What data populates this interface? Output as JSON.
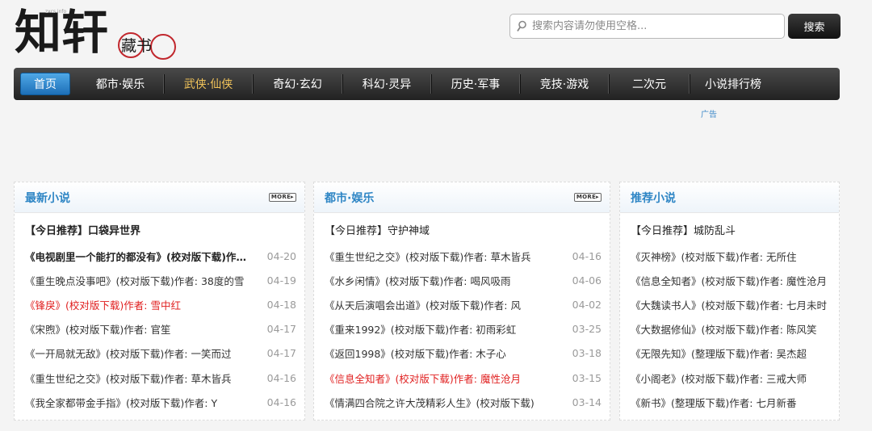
{
  "logo": {
    "name": "知轩藏书",
    "main_text": "知轩",
    "seal_text": "藏书",
    "small_text": "zxcs.info"
  },
  "search": {
    "placeholder": "搜索内容请勿使用空格...",
    "button_label": "搜索",
    "icon": "search-icon"
  },
  "nav": {
    "items": [
      {
        "label": "首页"
      },
      {
        "label": "都市·娱乐"
      },
      {
        "label": "武侠·仙侠"
      },
      {
        "label": "奇幻·玄幻"
      },
      {
        "label": "科幻·灵异"
      },
      {
        "label": "历史·军事"
      },
      {
        "label": "竞技·游戏"
      },
      {
        "label": "二次元"
      },
      {
        "label": "小说排行榜"
      }
    ]
  },
  "ad_label": "广告",
  "colors": {
    "accent_blue": "#2f86c5",
    "highlight_red": "#e02020",
    "nav_active": "#f2c45a"
  },
  "panels": [
    {
      "title": "最新小说",
      "more": "MORE",
      "featured": "【今日推荐】口袋异世界",
      "rows": [
        {
          "title": "《电视剧里一个能打的都没有》(校对版下载)作者: 吃瓜子群众",
          "date": "04-20"
        },
        {
          "title": "《重生晚点没事吧》(校对版下载)作者: 38度的雪",
          "date": "04-19"
        },
        {
          "title": "《锋戾》(校对版下载)作者: 雪中红",
          "date": "04-18"
        },
        {
          "title": "《宋煦》(校对版下载)作者: 官笙",
          "date": "04-17"
        },
        {
          "title": "《一开局就无敌》(校对版下载)作者: 一笑而过",
          "date": "04-17"
        },
        {
          "title": "《重生世纪之交》(校对版下载)作者: 草木皆兵",
          "date": "04-16"
        },
        {
          "title": "《我全家都带金手指》(校对版下载)作者: Y",
          "date": "04-16"
        }
      ]
    },
    {
      "title": "都市·娱乐",
      "more": "MORE",
      "featured": "【今日推荐】守护神域",
      "rows": [
        {
          "title": "《重生世纪之交》(校对版下载)作者: 草木皆兵",
          "date": "04-16"
        },
        {
          "title": "《水乡闲情》(校对版下载)作者: 喝风吸雨",
          "date": "04-06"
        },
        {
          "title": "《从天后演唱会出道》(校对版下载)作者: 风",
          "date": "04-02"
        },
        {
          "title": "《重来1992》(校对版下载)作者: 初雨彩虹",
          "date": "03-25"
        },
        {
          "title": "《返回1998》(校对版下载)作者: 木子心",
          "date": "03-18"
        },
        {
          "title": "《信息全知者》(校对版下载)作者: 魔性沧月",
          "date": "03-15"
        },
        {
          "title": "《情满四合院之许大茂精彩人生》(校对版下载)",
          "date": "03-14"
        }
      ]
    },
    {
      "title": "推荐小说",
      "featured": "【今日推荐】城防乱斗",
      "rows": [
        {
          "title": "《灭神榜》(校对版下载)作者: 无所住"
        },
        {
          "title": "《信息全知者》(校对版下载)作者: 魔性沧月"
        },
        {
          "title": "《大魏读书人》(校对版下载)作者: 七月未时"
        },
        {
          "title": "《大数据修仙》(校对版下载)作者: 陈风笑"
        },
        {
          "title": "《无限先知》(整理版下载)作者: 吴杰超"
        },
        {
          "title": "《小阁老》(校对版下载)作者: 三戒大师"
        },
        {
          "title": "《新书》(整理版下载)作者: 七月新番"
        }
      ]
    }
  ]
}
